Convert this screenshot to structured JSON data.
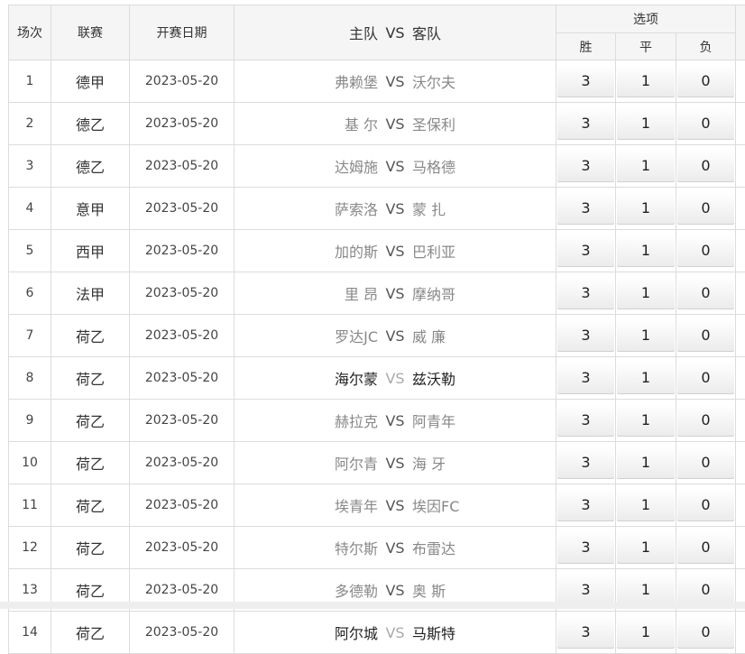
{
  "header": {
    "round": "场次",
    "league": "联赛",
    "date": "开赛日期",
    "home": "主队",
    "vs": "VS",
    "away": "客队",
    "options": "选项",
    "win": "胜",
    "draw": "平",
    "lose": "负"
  },
  "rows": [
    {
      "no": "1",
      "league": "德甲",
      "date": "2023-05-20",
      "home": "弗赖堡",
      "vs": "VS",
      "away": "沃尔夫",
      "win": "3",
      "draw": "1",
      "lose": "0",
      "dark": false
    },
    {
      "no": "2",
      "league": "德乙",
      "date": "2023-05-20",
      "home": "基 尔",
      "vs": "VS",
      "away": "圣保利",
      "win": "3",
      "draw": "1",
      "lose": "0",
      "dark": false
    },
    {
      "no": "3",
      "league": "德乙",
      "date": "2023-05-20",
      "home": "达姆施",
      "vs": "VS",
      "away": "马格德",
      "win": "3",
      "draw": "1",
      "lose": "0",
      "dark": false
    },
    {
      "no": "4",
      "league": "意甲",
      "date": "2023-05-20",
      "home": "萨索洛",
      "vs": "VS",
      "away": "蒙 扎",
      "win": "3",
      "draw": "1",
      "lose": "0",
      "dark": false
    },
    {
      "no": "5",
      "league": "西甲",
      "date": "2023-05-20",
      "home": "加的斯",
      "vs": "VS",
      "away": "巴利亚",
      "win": "3",
      "draw": "1",
      "lose": "0",
      "dark": false
    },
    {
      "no": "6",
      "league": "法甲",
      "date": "2023-05-20",
      "home": "里 昂",
      "vs": "VS",
      "away": "摩纳哥",
      "win": "3",
      "draw": "1",
      "lose": "0",
      "dark": false
    },
    {
      "no": "7",
      "league": "荷乙",
      "date": "2023-05-20",
      "home": "罗达JC",
      "vs": "VS",
      "away": "威 廉",
      "win": "3",
      "draw": "1",
      "lose": "0",
      "dark": false
    },
    {
      "no": "8",
      "league": "荷乙",
      "date": "2023-05-20",
      "home": "海尔蒙",
      "vs": "VS",
      "away": "兹沃勒",
      "win": "3",
      "draw": "1",
      "lose": "0",
      "dark": true
    },
    {
      "no": "9",
      "league": "荷乙",
      "date": "2023-05-20",
      "home": "赫拉克",
      "vs": "VS",
      "away": "阿青年",
      "win": "3",
      "draw": "1",
      "lose": "0",
      "dark": false
    },
    {
      "no": "10",
      "league": "荷乙",
      "date": "2023-05-20",
      "home": "阿尔青",
      "vs": "VS",
      "away": "海 牙",
      "win": "3",
      "draw": "1",
      "lose": "0",
      "dark": false
    },
    {
      "no": "11",
      "league": "荷乙",
      "date": "2023-05-20",
      "home": "埃青年",
      "vs": "VS",
      "away": "埃因FC",
      "win": "3",
      "draw": "1",
      "lose": "0",
      "dark": false
    },
    {
      "no": "12",
      "league": "荷乙",
      "date": "2023-05-20",
      "home": "特尔斯",
      "vs": "VS",
      "away": "布雷达",
      "win": "3",
      "draw": "1",
      "lose": "0",
      "dark": false
    },
    {
      "no": "13",
      "league": "荷乙",
      "date": "2023-05-20",
      "home": "多德勒",
      "vs": "VS",
      "away": "奥 斯",
      "win": "3",
      "draw": "1",
      "lose": "0",
      "dark": false
    },
    {
      "no": "14",
      "league": "荷乙",
      "date": "2023-05-20",
      "home": "阿尔城",
      "vs": "VS",
      "away": "马斯特",
      "win": "3",
      "draw": "1",
      "lose": "0",
      "dark": true
    }
  ]
}
